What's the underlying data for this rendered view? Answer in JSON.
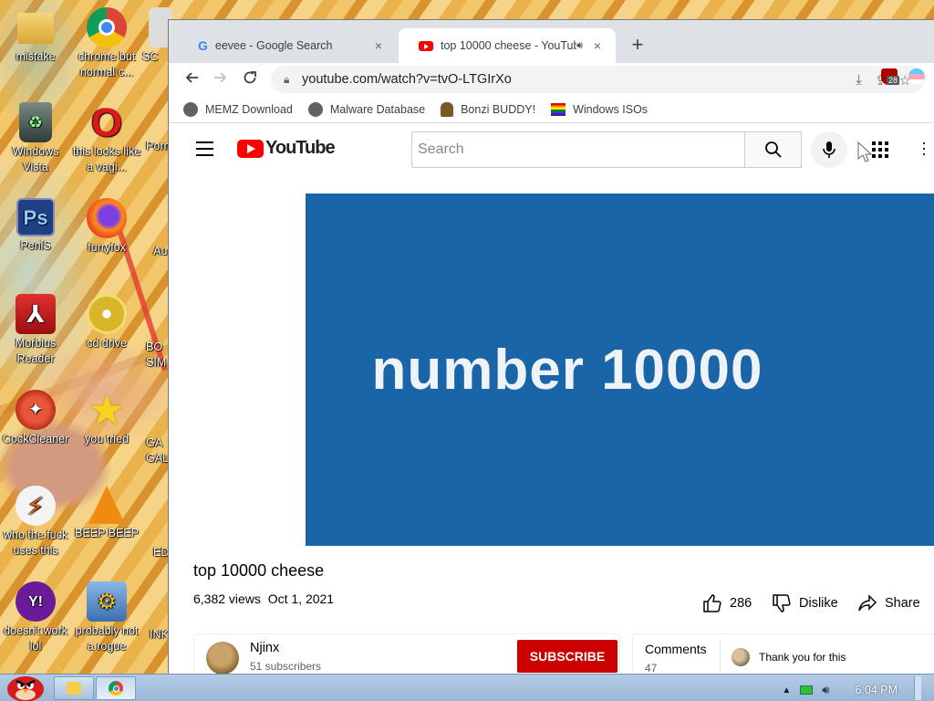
{
  "desktop": {
    "icons": [
      {
        "label": "mistake",
        "glyph": "folder"
      },
      {
        "label": "chrome but normal c...",
        "glyph": "chrome"
      },
      {
        "label": "SC",
        "glyph": "app"
      },
      {
        "label": "Windows Vista",
        "glyph": "recycle-bin"
      },
      {
        "label": "this looks like a vagi...",
        "glyph": "opera"
      },
      {
        "label": "Porn",
        "glyph": "folder"
      },
      {
        "label": "PeniS",
        "glyph": "photoshop"
      },
      {
        "label": "furryfox",
        "glyph": "firefox"
      },
      {
        "label": "Au",
        "glyph": "app"
      },
      {
        "label": "Morbius Reader",
        "glyph": "acrobat"
      },
      {
        "label": "cd drive",
        "glyph": "cd"
      },
      {
        "label": "BO SIM",
        "glyph": "app"
      },
      {
        "label": "CockCleaner",
        "glyph": "ccleaner"
      },
      {
        "label": "you tried",
        "glyph": "star"
      },
      {
        "label": "GA GAL",
        "glyph": "app"
      },
      {
        "label": "who the fuck uses this",
        "glyph": "winamp"
      },
      {
        "label": "BEEP BEEP",
        "glyph": "vlc"
      },
      {
        "label": "ED",
        "glyph": "app"
      },
      {
        "label": "doesn't work lol",
        "glyph": "yahoo"
      },
      {
        "label": "probably not a rogue",
        "glyph": "settings"
      },
      {
        "label": "INK",
        "glyph": "app"
      }
    ]
  },
  "browser": {
    "tabs": [
      {
        "title": "eevee - Google Search",
        "favicon": "google-icon",
        "close": "×"
      },
      {
        "title": "top 10000 cheese - YouTube",
        "favicon": "youtube-icon",
        "audio": "speaker-icon",
        "close": "×"
      }
    ],
    "new_tab": "+",
    "url": "youtube.com/watch?v=tvO-LTGIrXo",
    "extension_badge": "28",
    "bookmarks": [
      {
        "label": "MEMZ Download",
        "icon": "globe-icon"
      },
      {
        "label": "Malware Database",
        "icon": "globe-icon"
      },
      {
        "label": "Bonzi BUDDY!",
        "icon": "bonzi-icon"
      },
      {
        "label": "Windows ISOs",
        "icon": "rainbow-flag-icon"
      }
    ]
  },
  "youtube": {
    "logo_text": "YouTube",
    "search_placeholder": "Search",
    "video_overlay_text": "number 10000",
    "video_title": "top 10000 cheese",
    "views": "6,382 views",
    "date": "Oct 1, 2021",
    "likes": "286",
    "dislike_label": "Dislike",
    "share_label": "Share",
    "channel": {
      "name": "Njinx",
      "subscribers": "51 subscribers"
    },
    "subscribe_label": "SUBSCRIBE",
    "comments": {
      "label": "Comments",
      "count": "47",
      "preview": "Thank you for this"
    }
  },
  "taskbar": {
    "clock": "6:04 PM"
  },
  "colors": {
    "video_bg": "#1a64a8",
    "youtube_red": "#ff0000",
    "subscribe_red": "#cc0000",
    "tabstrip": "#dee1e6",
    "taskbar": "#a9c1de"
  }
}
